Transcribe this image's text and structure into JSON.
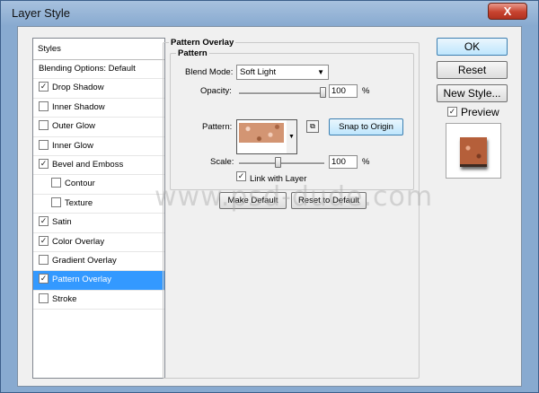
{
  "window": {
    "title": "Layer Style",
    "close_glyph": "X"
  },
  "styles_list": {
    "header": "Styles",
    "items": [
      {
        "label": "Blending Options: Default",
        "checkbox": false,
        "checked": false
      },
      {
        "label": "Drop Shadow",
        "checkbox": true,
        "checked": true
      },
      {
        "label": "Inner Shadow",
        "checkbox": true,
        "checked": false
      },
      {
        "label": "Outer Glow",
        "checkbox": true,
        "checked": false
      },
      {
        "label": "Inner Glow",
        "checkbox": true,
        "checked": false
      },
      {
        "label": "Bevel and Emboss",
        "checkbox": true,
        "checked": true
      },
      {
        "label": "Contour",
        "checkbox": true,
        "checked": false,
        "sub": true
      },
      {
        "label": "Texture",
        "checkbox": true,
        "checked": false,
        "sub": true
      },
      {
        "label": "Satin",
        "checkbox": true,
        "checked": true
      },
      {
        "label": "Color Overlay",
        "checkbox": true,
        "checked": true
      },
      {
        "label": "Gradient Overlay",
        "checkbox": true,
        "checked": false
      },
      {
        "label": "Pattern Overlay",
        "checkbox": true,
        "checked": true,
        "selected": true
      },
      {
        "label": "Stroke",
        "checkbox": true,
        "checked": false
      }
    ]
  },
  "panel": {
    "group_title": "Pattern Overlay",
    "inner_title": "Pattern",
    "blend_mode_label": "Blend Mode:",
    "blend_mode_value": "Soft Light",
    "opacity_label": "Opacity:",
    "opacity_value": "100",
    "opacity_percent": 100,
    "opacity_unit": "%",
    "pattern_label": "Pattern:",
    "snap_button": "Snap to Origin",
    "scale_label": "Scale:",
    "scale_value": "100",
    "scale_unit": "%",
    "link_label": "Link with Layer",
    "link_checked": true,
    "make_default": "Make Default",
    "reset_default": "Reset to Default"
  },
  "side": {
    "ok": "OK",
    "reset": "Reset",
    "new_style": "New Style...",
    "preview_label": "Preview",
    "preview_checked": true
  },
  "watermark": "www.psd-dude.com",
  "colors": {
    "selection": "#3399ff",
    "title_gradient": "#88aad0",
    "close_button": "#c7432f"
  }
}
